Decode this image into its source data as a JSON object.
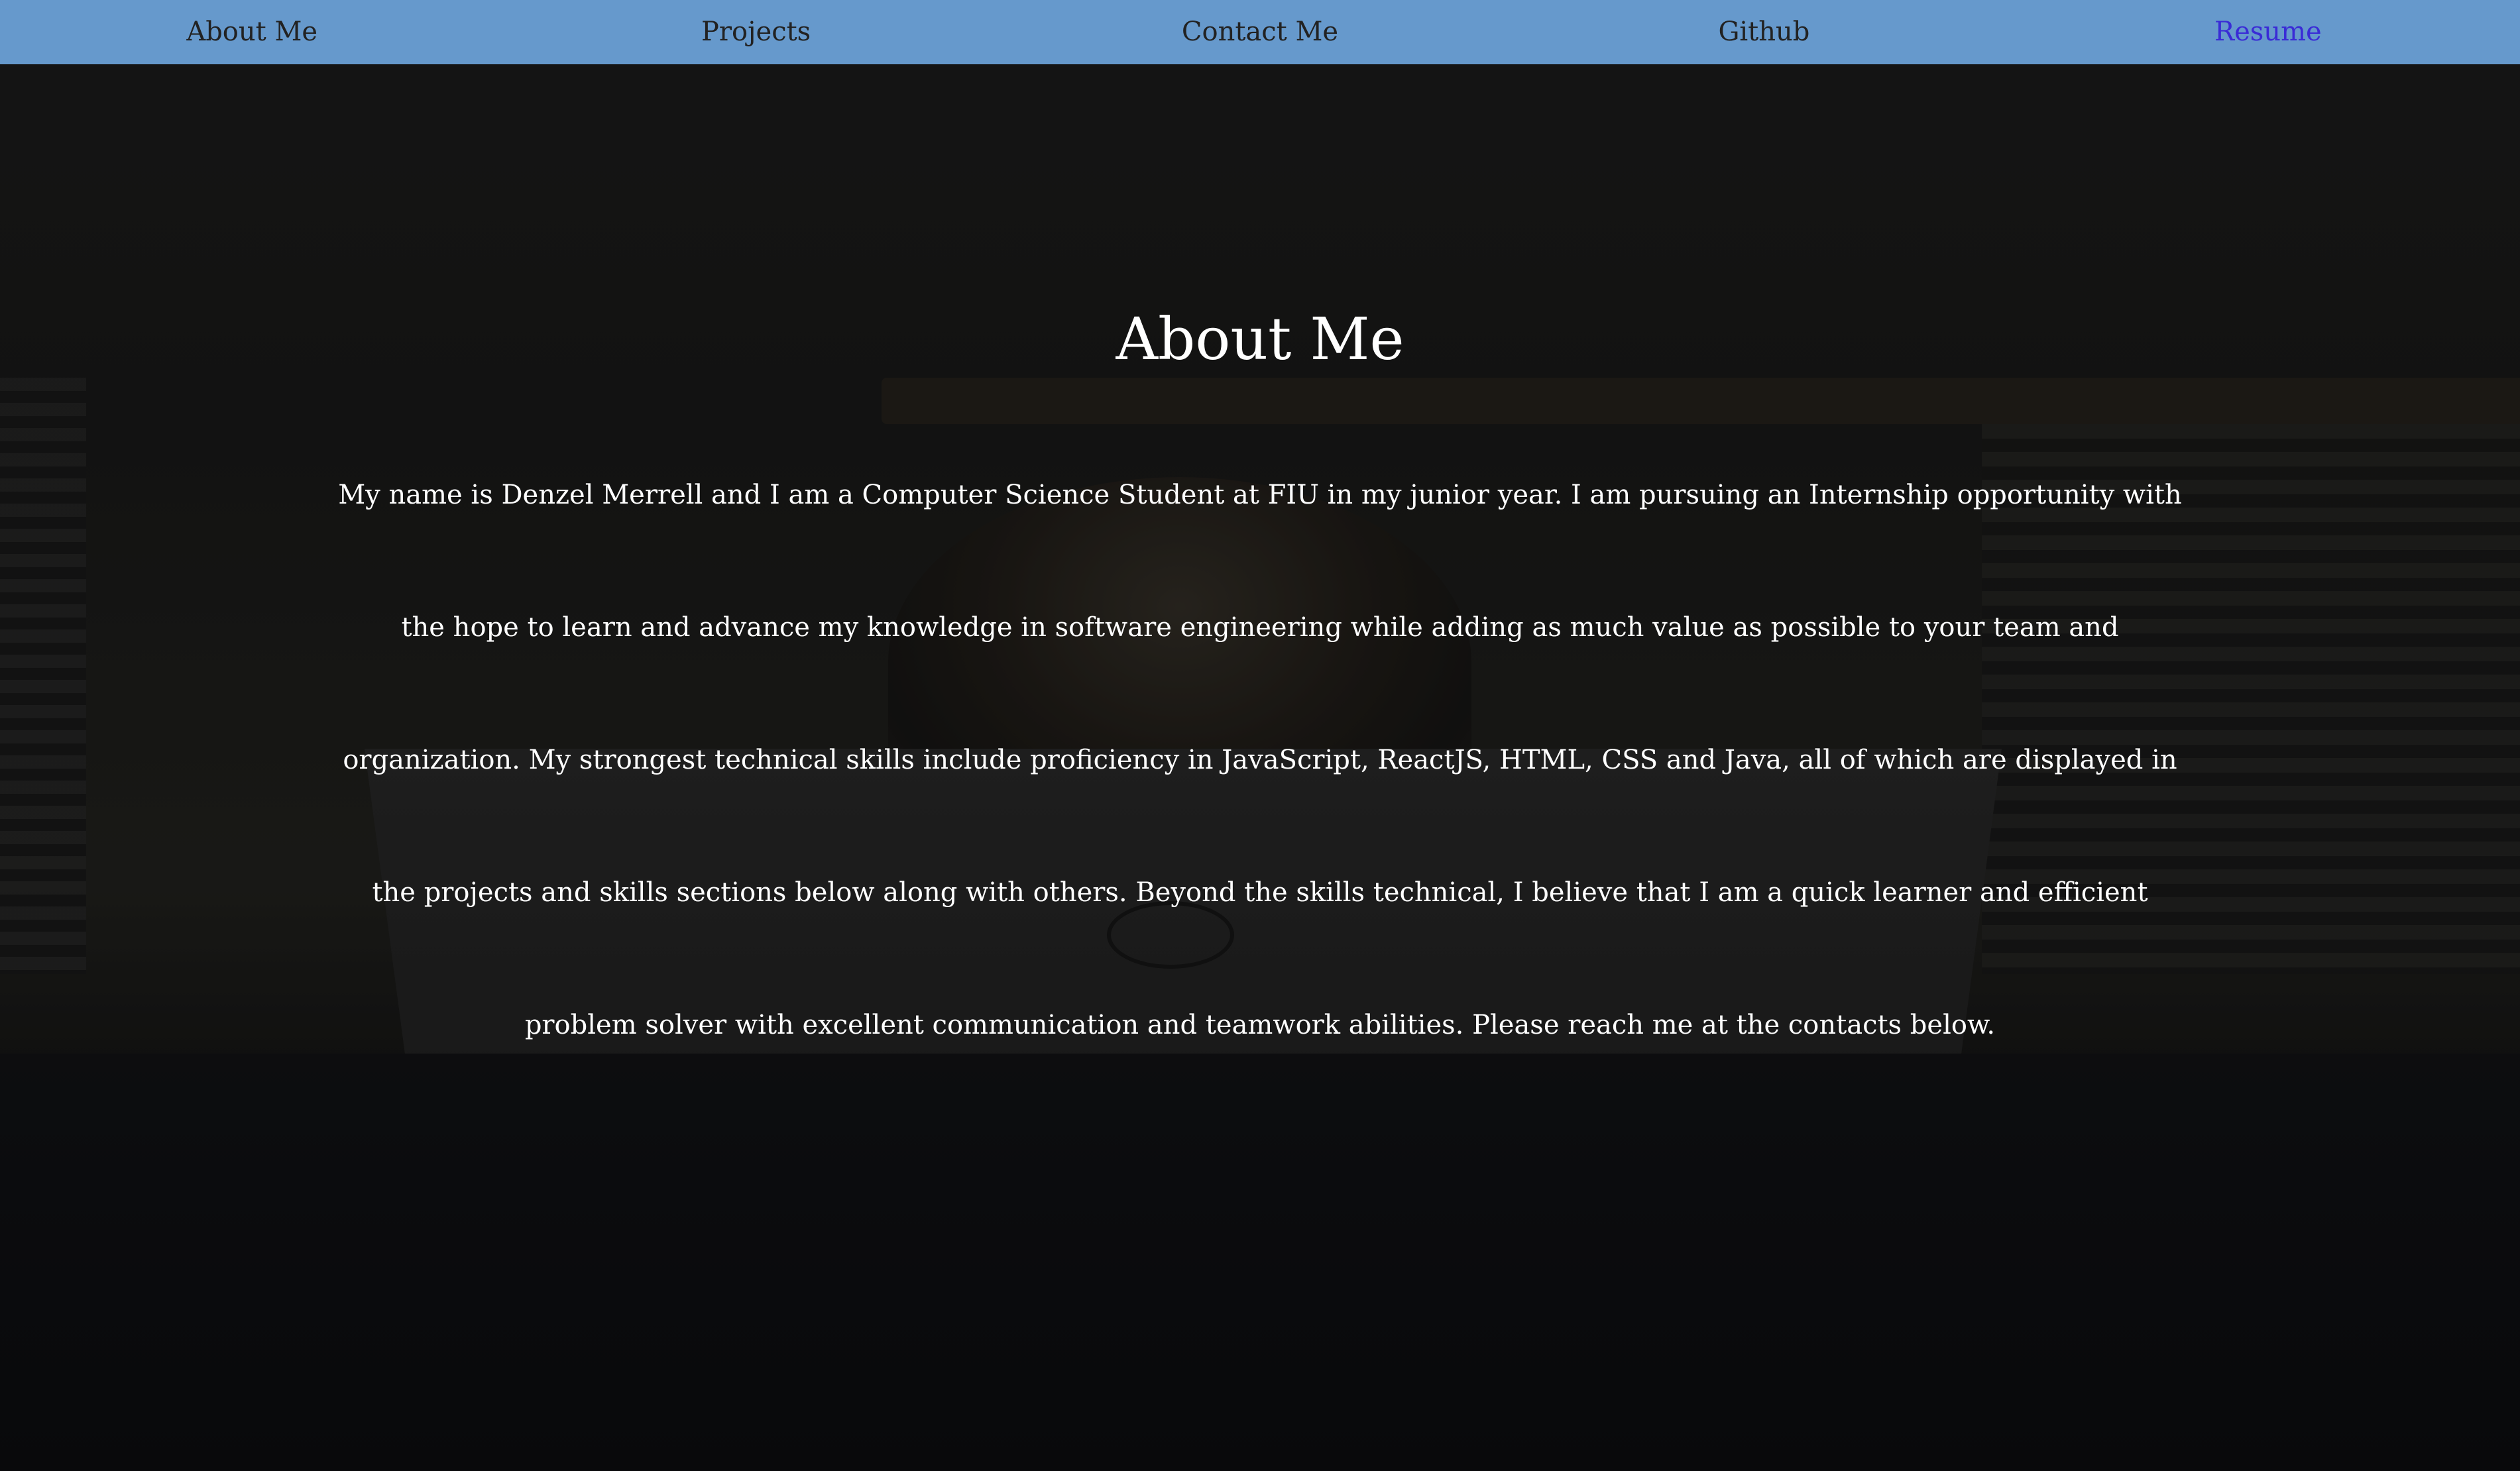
{
  "nav": {
    "items": [
      {
        "label": "About Me"
      },
      {
        "label": "Projects"
      },
      {
        "label": "Contact Me"
      },
      {
        "label": "Github"
      },
      {
        "label": "Resume"
      }
    ],
    "bar_color": "#6699cc",
    "resume_color": "#3a2bd6"
  },
  "about": {
    "title": "About Me",
    "body": "My name is Denzel Merrell and I am a Computer Science Student at FIU in my junior year. I am pursuing an Internship opportunity with the hope to learn and advance my knowledge in software engineering while adding as much value as possible to your team and organization. My strongest technical skills include proficiency in JavaScript, ReactJS, HTML, CSS and Java, all of which are displayed in the projects and skills sections below along with others. Beyond the skills technical, I believe that I am a quick learner and efficient problem solver with excellent communication and teamwork abilities. Please reach me at the contacts below."
  }
}
